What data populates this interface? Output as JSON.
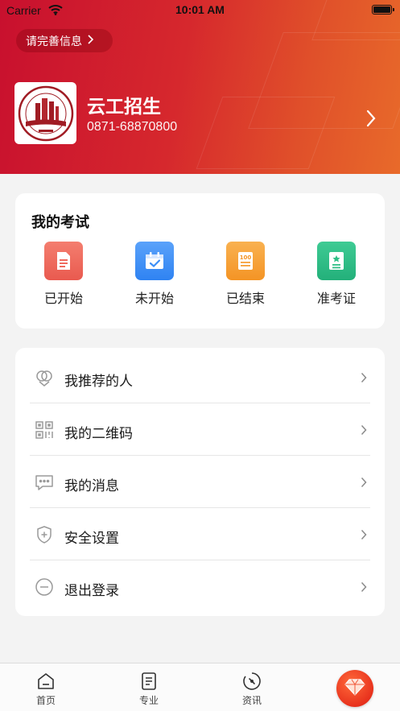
{
  "status_bar": {
    "carrier": "Carrier",
    "time": "10:01 AM"
  },
  "header": {
    "complete_info_label": "请完善信息",
    "school_name": "云工招生",
    "school_phone": "0871-68870800"
  },
  "exam": {
    "title": "我的考试",
    "items": [
      {
        "label": "已开始",
        "icon": "document-icon",
        "color": "#f06a5e"
      },
      {
        "label": "未开始",
        "icon": "calendar-check-icon",
        "color": "#3d8ff7"
      },
      {
        "label": "已结束",
        "icon": "score-100-icon",
        "color": "#f7a038"
      },
      {
        "label": "准考证",
        "icon": "admission-ticket-icon",
        "color": "#2fbf86"
      }
    ]
  },
  "menu": {
    "items": [
      {
        "label": "我推荐的人",
        "icon": "referral-icon"
      },
      {
        "label": "我的二维码",
        "icon": "qr-code-icon"
      },
      {
        "label": "我的消息",
        "icon": "message-icon"
      },
      {
        "label": "安全设置",
        "icon": "shield-icon"
      },
      {
        "label": "退出登录",
        "icon": "logout-icon"
      }
    ]
  },
  "tabbar": {
    "items": [
      {
        "label": "首页",
        "icon": "home-icon"
      },
      {
        "label": "专业",
        "icon": "list-document-icon"
      },
      {
        "label": "资讯",
        "icon": "news-compass-icon"
      }
    ],
    "special_icon": "gem-icon"
  },
  "colors": {
    "brand_red": "#c8102e",
    "brand_orange": "#e86a2a"
  }
}
